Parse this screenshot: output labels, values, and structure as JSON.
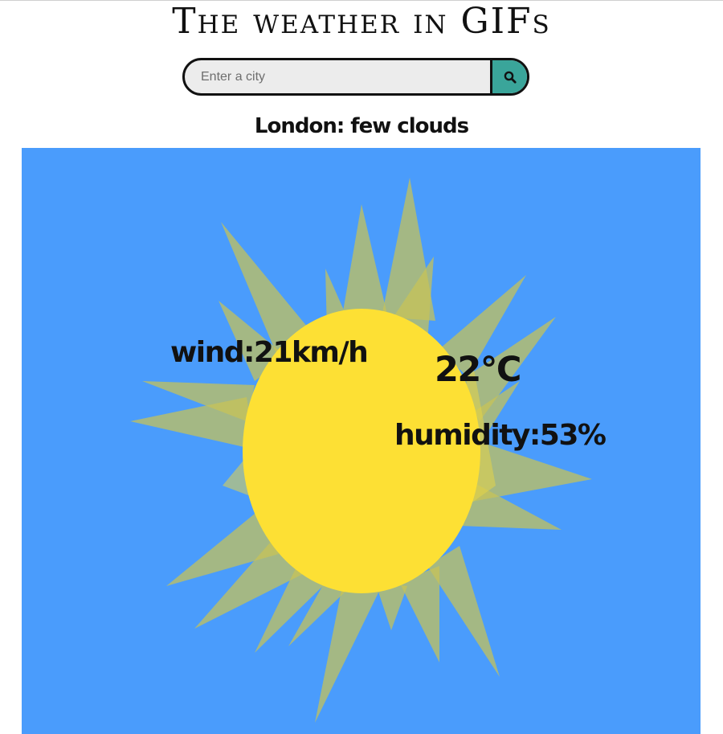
{
  "header": {
    "title": "The weather in GIFs"
  },
  "search": {
    "placeholder": "Enter a city",
    "value": "",
    "button_icon": "search-icon",
    "button_color": "#3aa59a"
  },
  "location": {
    "heading": "London: few clouds"
  },
  "weather": {
    "wind": "wind:21km/h",
    "temperature": "22°C",
    "humidity": "humidity:53%",
    "background_color": "#4a9cfc",
    "sun_color": "#fde034",
    "ray_color": "#c8c456",
    "illustration": "sun-gif"
  }
}
